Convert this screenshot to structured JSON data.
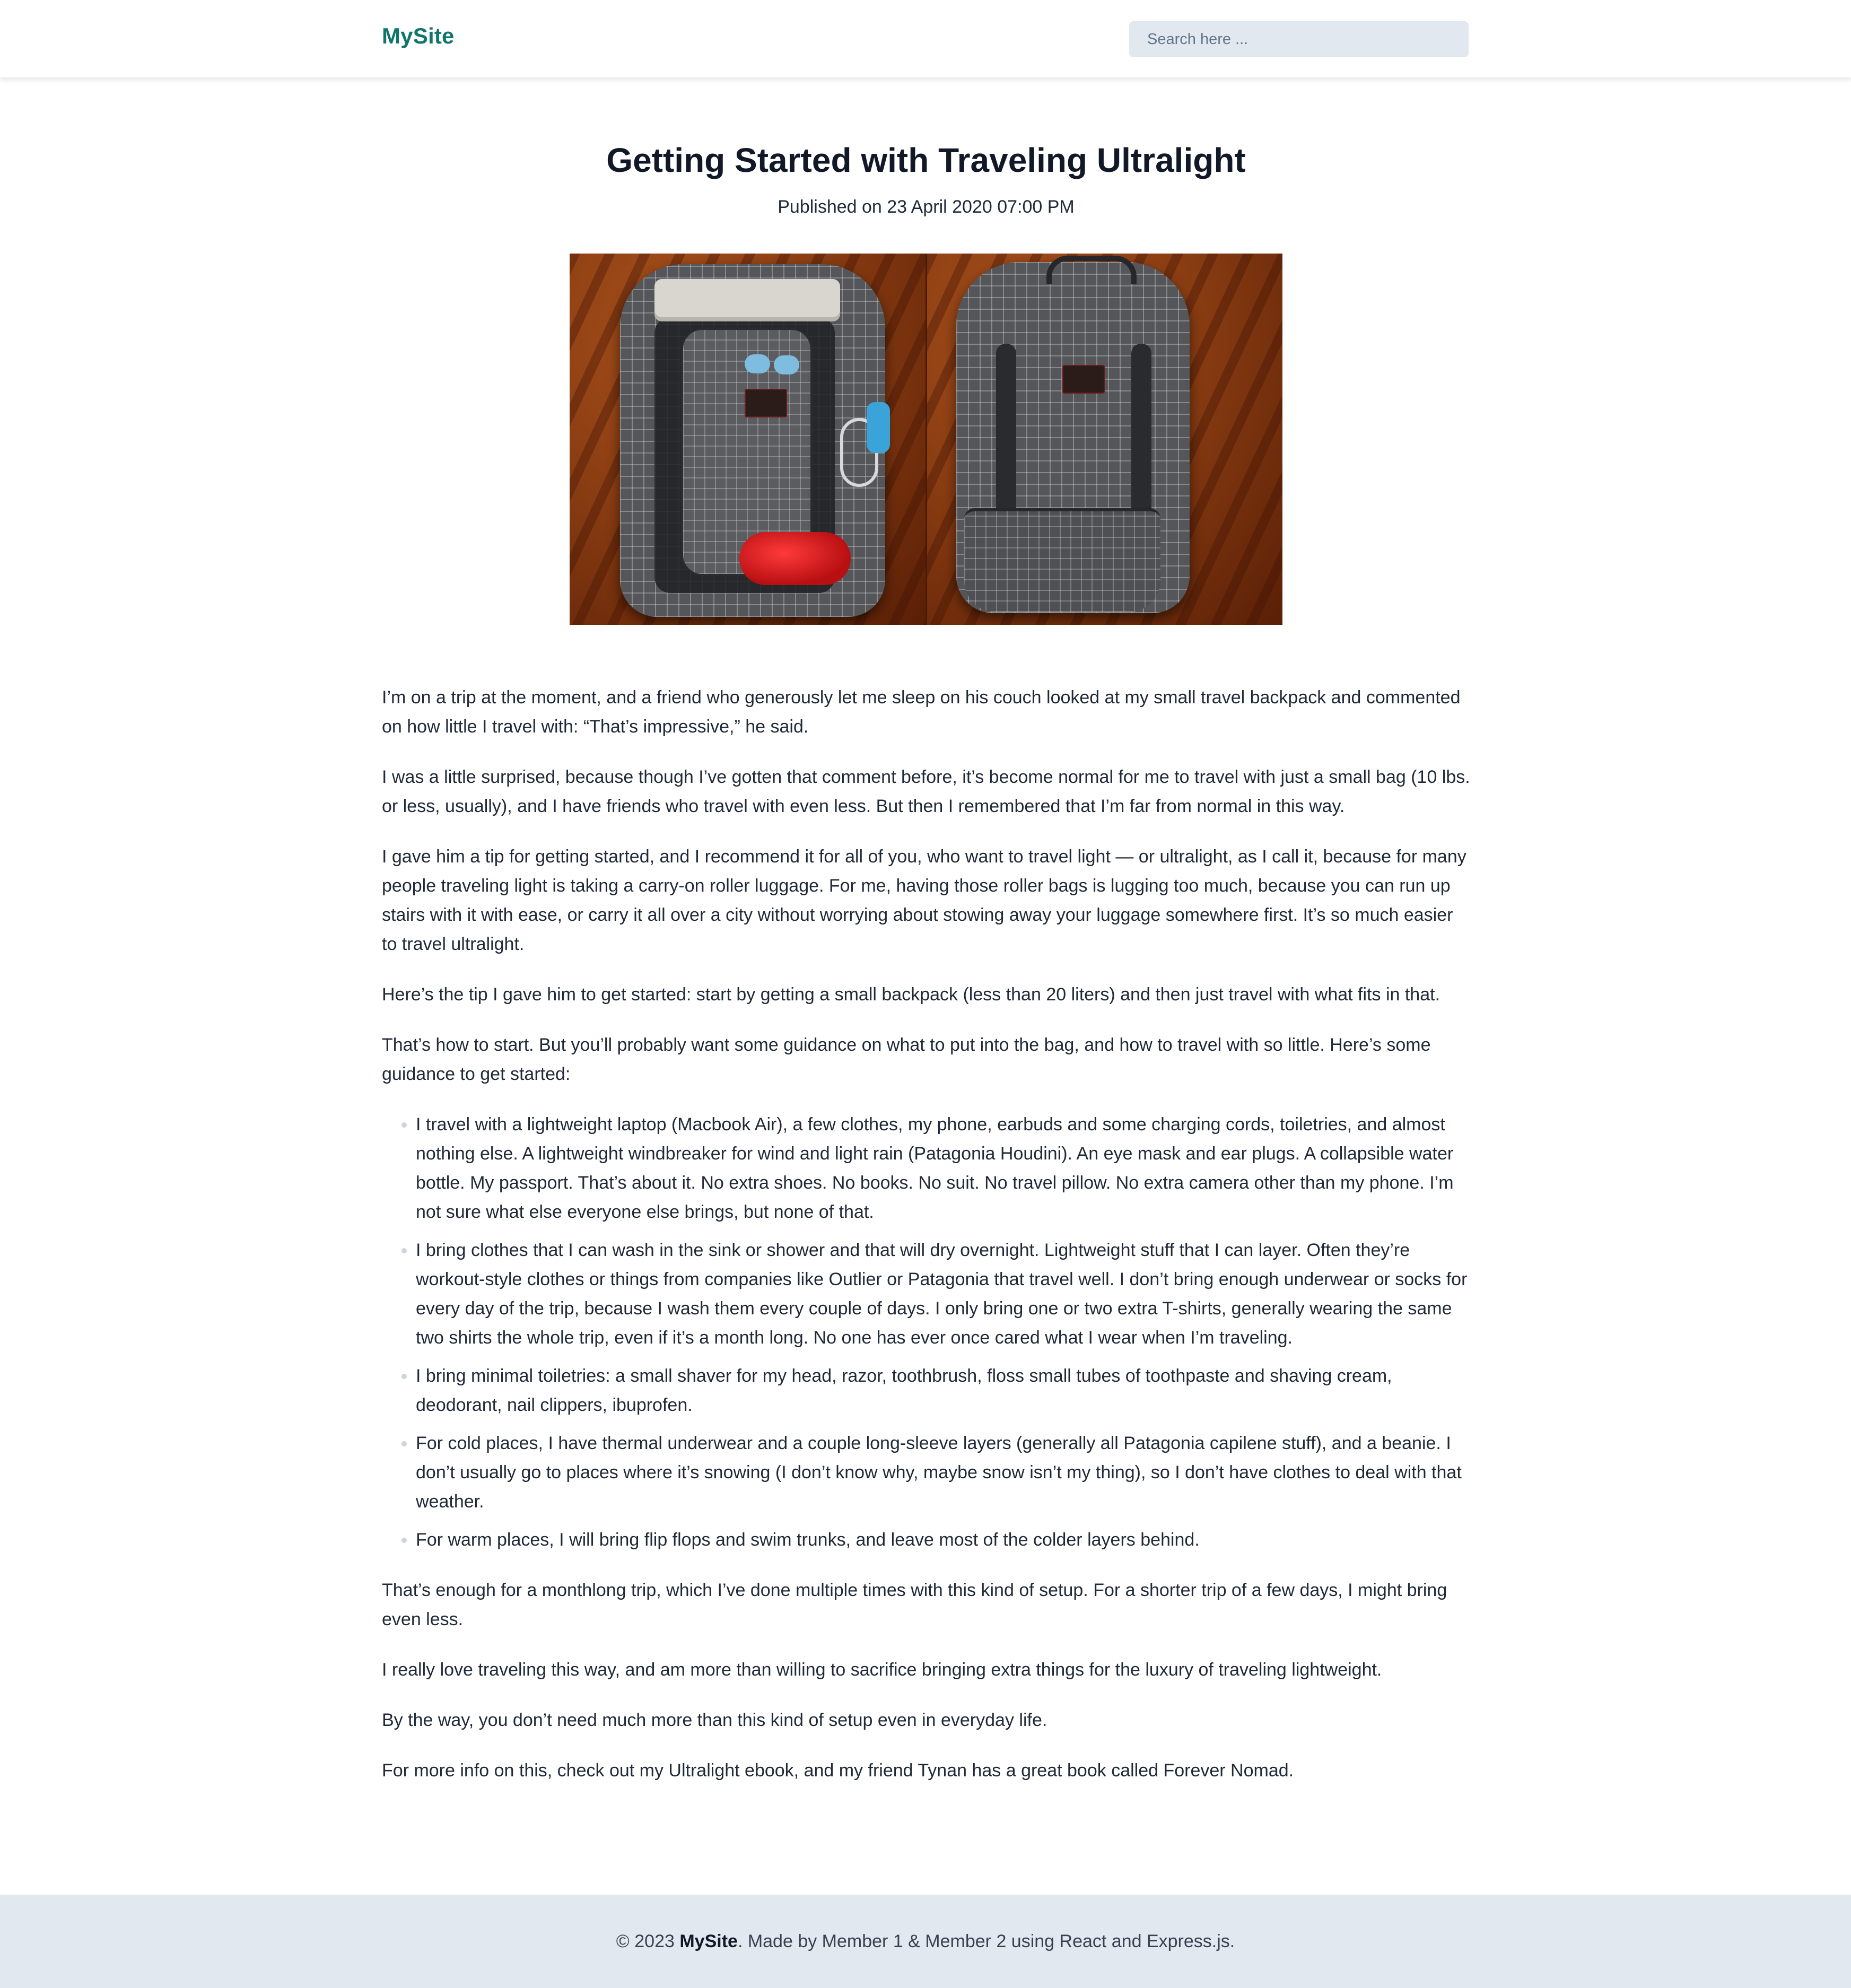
{
  "header": {
    "logo": "MySite",
    "search_placeholder": "Search here ..."
  },
  "article": {
    "title": "Getting Started with Traveling Ultralight",
    "published": "Published on 23 April 2020 07:00 PM",
    "paragraphs_top": [
      "I’m on a trip at the moment, and a friend who generously let me sleep on his couch looked at my small travel backpack and commented on how little I travel with: “That’s impressive,” he said.",
      "I was a little surprised, because though I’ve gotten that comment before, it’s become normal for me to travel with just a small bag (10 lbs. or less, usually), and I have friends who travel with even less. But then I remembered that I’m far from normal in this way.",
      "I gave him a tip for getting started, and I recommend it for all of you, who want to travel light — or ultralight, as I call it, because for many people traveling light is taking a carry-on roller luggage. For me, having those roller bags is lugging too much, because you can run up stairs with it with ease, or carry it all over a city without worrying about stowing away your luggage somewhere first. It’s so much easier to travel ultralight.",
      "Here’s the tip I gave him to get started: start by getting a small backpack (less than 20 liters) and then just travel with what fits in that.",
      "That’s how to start. But you’ll probably want some guidance on what to put into the bag, and how to travel with so little. Here’s some guidance to get started:"
    ],
    "list_items": [
      "I travel with a lightweight laptop (Macbook Air), a few clothes, my phone, earbuds and some charging cords, toiletries, and almost nothing else. A lightweight windbreaker for wind and light rain (Patagonia Houdini). An eye mask and ear plugs. A collapsible water bottle. My passport. That’s about it. No extra shoes. No books. No suit. No travel pillow. No extra camera other than my phone. I’m not sure what else everyone else brings, but none of that.",
      "I bring clothes that I can wash in the sink or shower and that will dry overnight. Lightweight stuff that I can layer. Often they’re workout-style clothes or things from companies like Outlier or Patagonia that travel well. I don’t bring enough underwear or socks for every day of the trip, because I wash them every couple of days. I only bring one or two extra T-shirts, generally wearing the same two shirts the whole trip, even if it’s a month long. No one has ever once cared what I wear when I’m traveling.",
      "I bring minimal toiletries: a small shaver for my head, razor, toothbrush, floss small tubes of toothpaste and shaving cream, deodorant, nail clippers, ibuprofen.",
      "For cold places, I have thermal underwear and a couple long-sleeve layers (generally all Patagonia capilene stuff), and a beanie. I don’t usually go to places where it’s snowing (I don’t know why, maybe snow isn’t my thing), so I don’t have clothes to deal with that weather.",
      "For warm places, I will bring flip flops and swim trunks, and leave most of the colder layers behind."
    ],
    "paragraphs_bottom": [
      "That’s enough for a monthlong trip, which I’ve done multiple times with this kind of setup. For a shorter trip of a few days, I might bring even less.",
      "I really love traveling this way, and am more than willing to sacrifice bringing extra things for the luxury of traveling lightweight.",
      "By the way, you don’t need much more than this kind of setup even in everyday life.",
      "For more info on this, check out my Ultralight ebook, and my friend Tynan has a great book called Forever Nomad."
    ]
  },
  "footer": {
    "prefix": "© 2023 ",
    "brand": "MySite",
    "suffix": ". Made by Member 1 & Member 2 using React and Express.js."
  },
  "colors": {
    "brand": "#0f766e",
    "search_bg": "#e2e8f0",
    "footer_bg": "#e2e8f0",
    "text": "#1f2937"
  }
}
